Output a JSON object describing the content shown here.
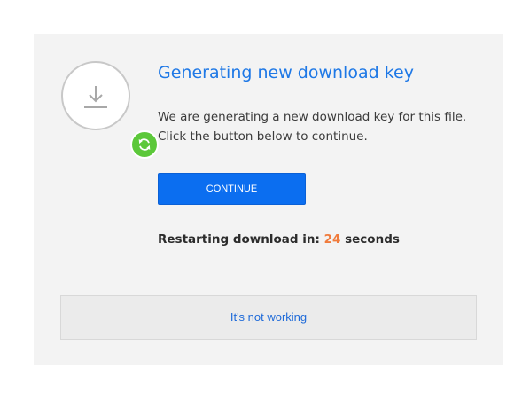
{
  "dialog": {
    "title": "Generating new download key",
    "description_line1": "We are generating a new download key for this file.",
    "description_line2": "Click the button below to continue.",
    "continue_label": "CONTINUE",
    "restart_prefix": "Restarting download in:",
    "restart_count": "24",
    "restart_suffix": "seconds",
    "not_working_label": "It's not working"
  },
  "icons": {
    "main": "download-icon",
    "badge": "refresh-icon"
  },
  "colors": {
    "accent": "#1e78e6",
    "button": "#0b6ef0",
    "badge": "#5cc83a",
    "countdown": "#f07b3c",
    "panel_bg": "#f3f3f3"
  }
}
